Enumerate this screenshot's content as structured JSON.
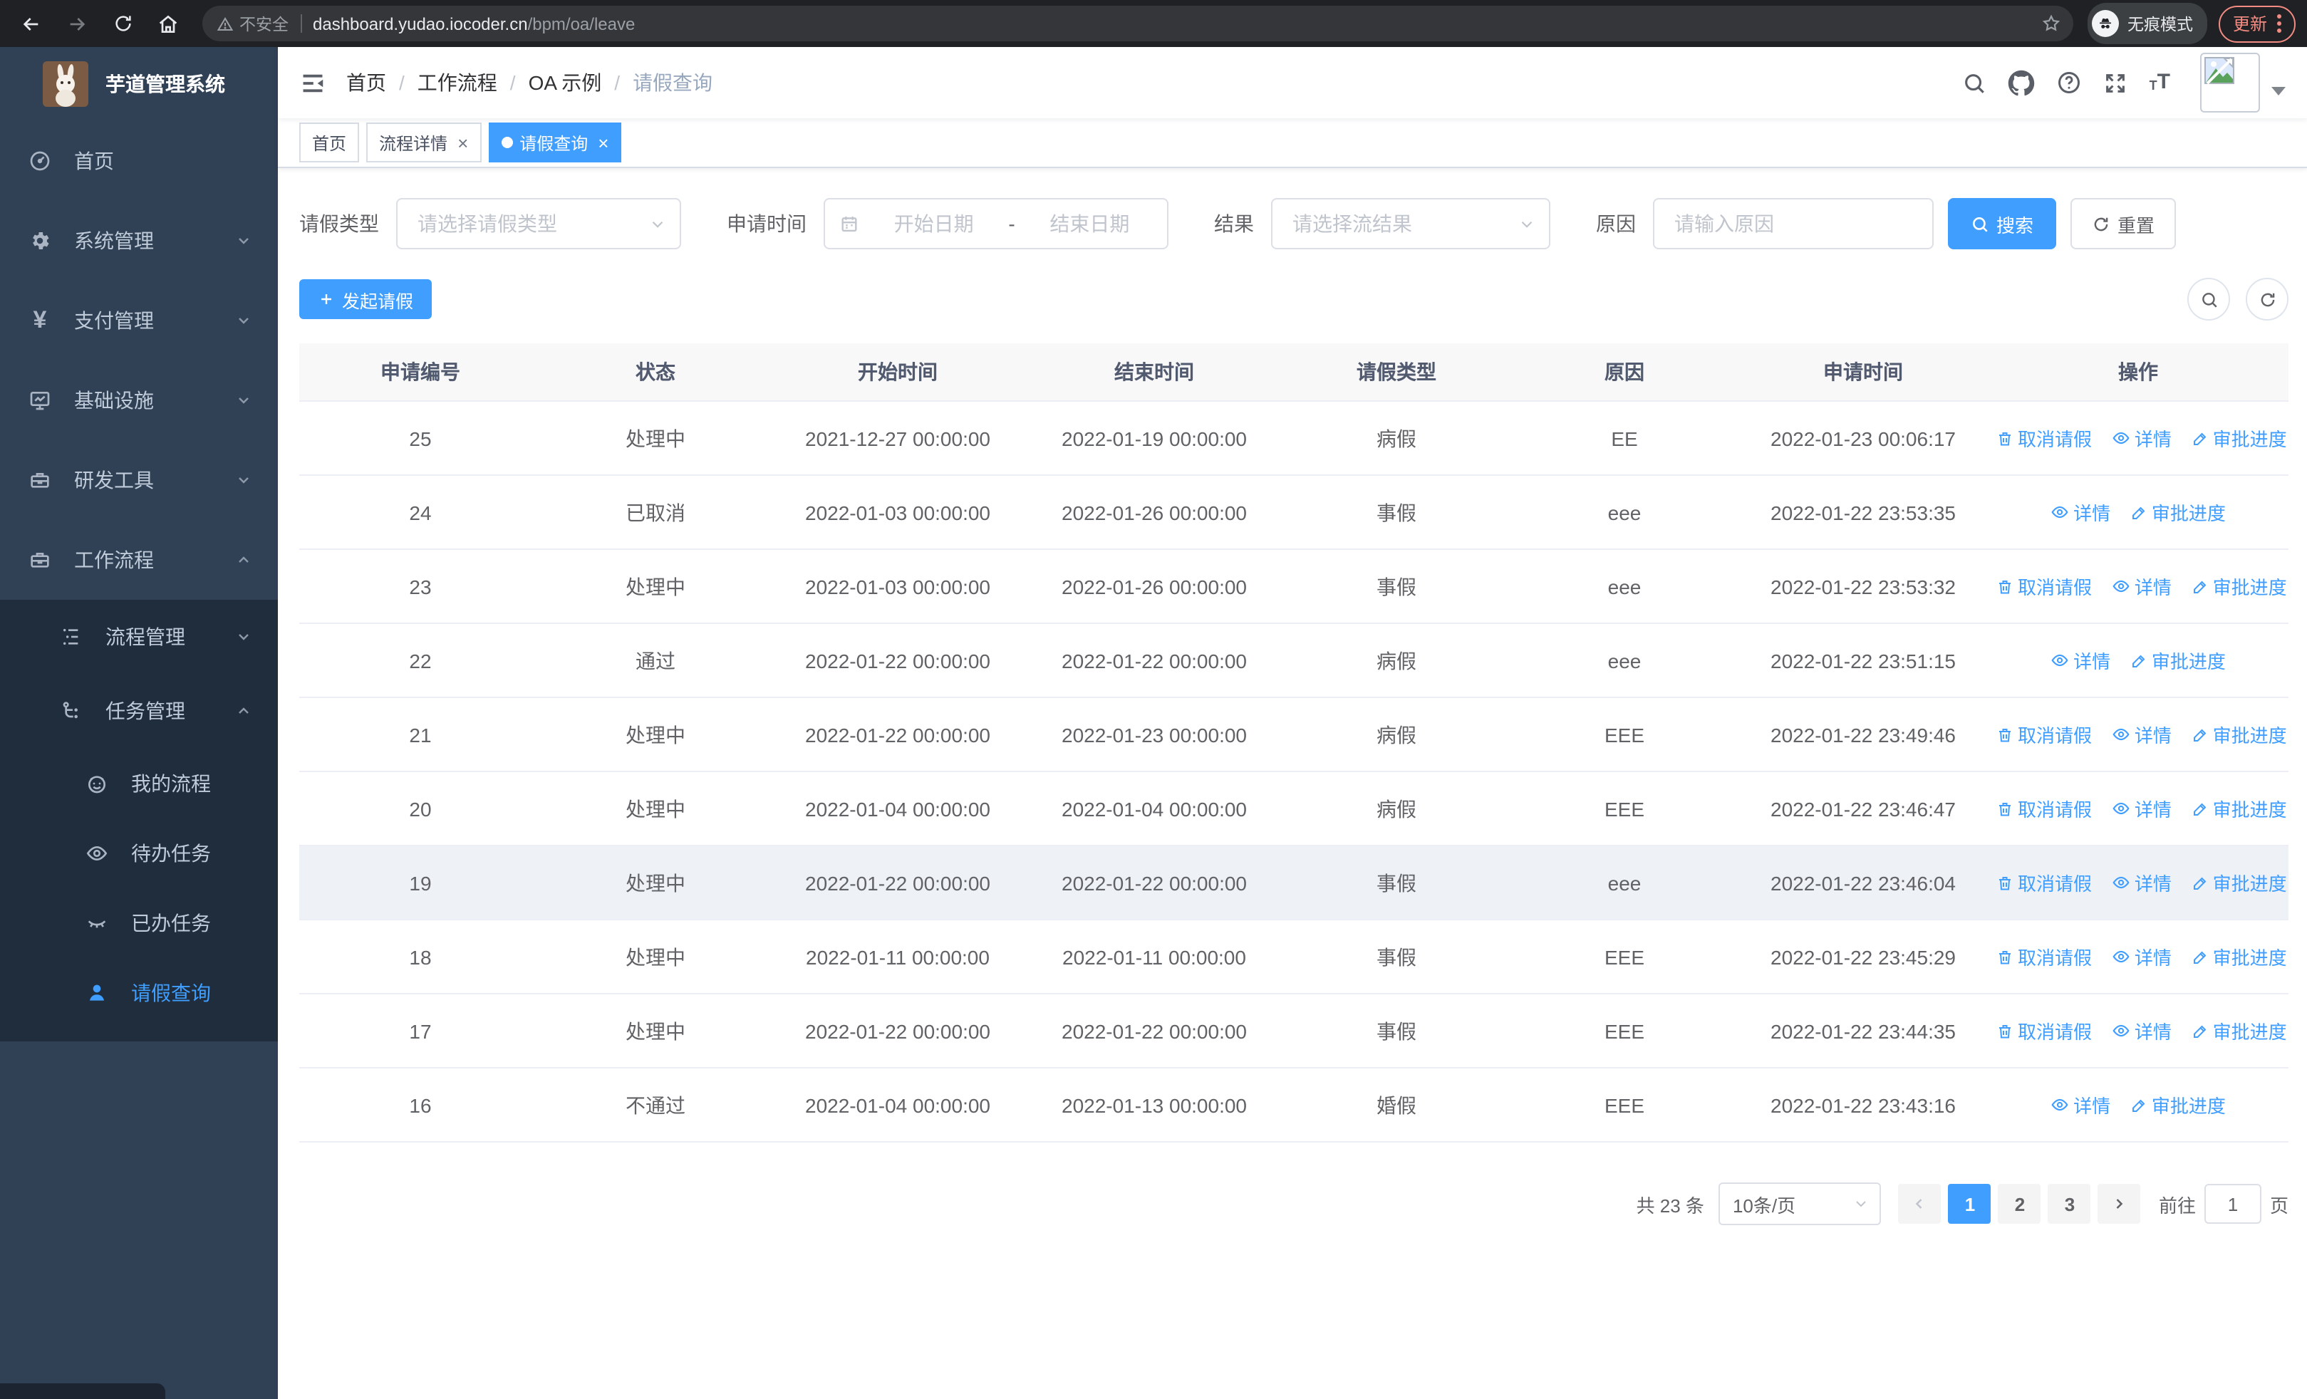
{
  "browser": {
    "security_warning": "不安全",
    "url_host": "dashboard.yudao.iocoder.cn",
    "url_path": "/bpm/oa/leave",
    "incognito_label": "无痕模式",
    "update_label": "更新"
  },
  "colors": {
    "accent": "#409eff",
    "sidebar_bg": "#304156",
    "submenu_bg": "#1f2d3d",
    "update_chip": "#f28b82",
    "table_header_bg": "#f8f8f9"
  },
  "sidebar": {
    "app_title": "芋道管理系统",
    "items": [
      {
        "label": "首页"
      },
      {
        "label": "系统管理"
      },
      {
        "label": "支付管理"
      },
      {
        "label": "基础设施"
      },
      {
        "label": "研发工具"
      },
      {
        "label": "工作流程"
      },
      {
        "label": "流程管理"
      },
      {
        "label": "任务管理"
      },
      {
        "label": "我的流程"
      },
      {
        "label": "待办任务"
      },
      {
        "label": "已办任务"
      },
      {
        "label": "请假查询"
      }
    ]
  },
  "breadcrumb": {
    "items": [
      "首页",
      "工作流程",
      "OA 示例",
      "请假查询"
    ]
  },
  "tabs": [
    {
      "label": "首页"
    },
    {
      "label": "流程详情"
    },
    {
      "label": "请假查询"
    }
  ],
  "filters": {
    "leave_type": {
      "label": "请假类型",
      "placeholder": "请选择请假类型"
    },
    "apply_time": {
      "label": "申请时间",
      "start_placeholder": "开始日期",
      "separator": "-",
      "end_placeholder": "结束日期"
    },
    "result": {
      "label": "结果",
      "placeholder": "请选择流结果"
    },
    "reason": {
      "label": "原因",
      "placeholder": "请输入原因"
    },
    "search_label": "搜索",
    "reset_label": "重置"
  },
  "toolbar": {
    "create_label": "发起请假"
  },
  "table": {
    "columns": [
      "申请编号",
      "状态",
      "开始时间",
      "结束时间",
      "请假类型",
      "原因",
      "申请时间",
      "操作"
    ],
    "action_labels": {
      "cancel": "取消请假",
      "detail": "详情",
      "progress": "审批进度"
    },
    "rows": [
      {
        "id": "25",
        "status": "处理中",
        "start": "2021-12-27 00:00:00",
        "end": "2022-01-19 00:00:00",
        "type": "病假",
        "reason": "EE",
        "applied": "2022-01-23 00:06:17",
        "can_cancel": true,
        "highlight": false
      },
      {
        "id": "24",
        "status": "已取消",
        "start": "2022-01-03 00:00:00",
        "end": "2022-01-26 00:00:00",
        "type": "事假",
        "reason": "eee",
        "applied": "2022-01-22 23:53:35",
        "can_cancel": false,
        "highlight": false
      },
      {
        "id": "23",
        "status": "处理中",
        "start": "2022-01-03 00:00:00",
        "end": "2022-01-26 00:00:00",
        "type": "事假",
        "reason": "eee",
        "applied": "2022-01-22 23:53:32",
        "can_cancel": true,
        "highlight": false
      },
      {
        "id": "22",
        "status": "通过",
        "start": "2022-01-22 00:00:00",
        "end": "2022-01-22 00:00:00",
        "type": "病假",
        "reason": "eee",
        "applied": "2022-01-22 23:51:15",
        "can_cancel": false,
        "highlight": false
      },
      {
        "id": "21",
        "status": "处理中",
        "start": "2022-01-22 00:00:00",
        "end": "2022-01-23 00:00:00",
        "type": "病假",
        "reason": "EEE",
        "applied": "2022-01-22 23:49:46",
        "can_cancel": true,
        "highlight": false
      },
      {
        "id": "20",
        "status": "处理中",
        "start": "2022-01-04 00:00:00",
        "end": "2022-01-04 00:00:00",
        "type": "病假",
        "reason": "EEE",
        "applied": "2022-01-22 23:46:47",
        "can_cancel": true,
        "highlight": false
      },
      {
        "id": "19",
        "status": "处理中",
        "start": "2022-01-22 00:00:00",
        "end": "2022-01-22 00:00:00",
        "type": "事假",
        "reason": "eee",
        "applied": "2022-01-22 23:46:04",
        "can_cancel": true,
        "highlight": true
      },
      {
        "id": "18",
        "status": "处理中",
        "start": "2022-01-11 00:00:00",
        "end": "2022-01-11 00:00:00",
        "type": "事假",
        "reason": "EEE",
        "applied": "2022-01-22 23:45:29",
        "can_cancel": true,
        "highlight": false
      },
      {
        "id": "17",
        "status": "处理中",
        "start": "2022-01-22 00:00:00",
        "end": "2022-01-22 00:00:00",
        "type": "事假",
        "reason": "EEE",
        "applied": "2022-01-22 23:44:35",
        "can_cancel": true,
        "highlight": false
      },
      {
        "id": "16",
        "status": "不通过",
        "start": "2022-01-04 00:00:00",
        "end": "2022-01-13 00:00:00",
        "type": "婚假",
        "reason": "EEE",
        "applied": "2022-01-22 23:43:16",
        "can_cancel": false,
        "highlight": false
      }
    ]
  },
  "pagination": {
    "total_text": "共 23 条",
    "page_size": "10条/页",
    "pages": [
      "1",
      "2",
      "3"
    ],
    "active_page": "1",
    "goto_label": "前往",
    "goto_value": "1",
    "page_suffix": "页"
  }
}
